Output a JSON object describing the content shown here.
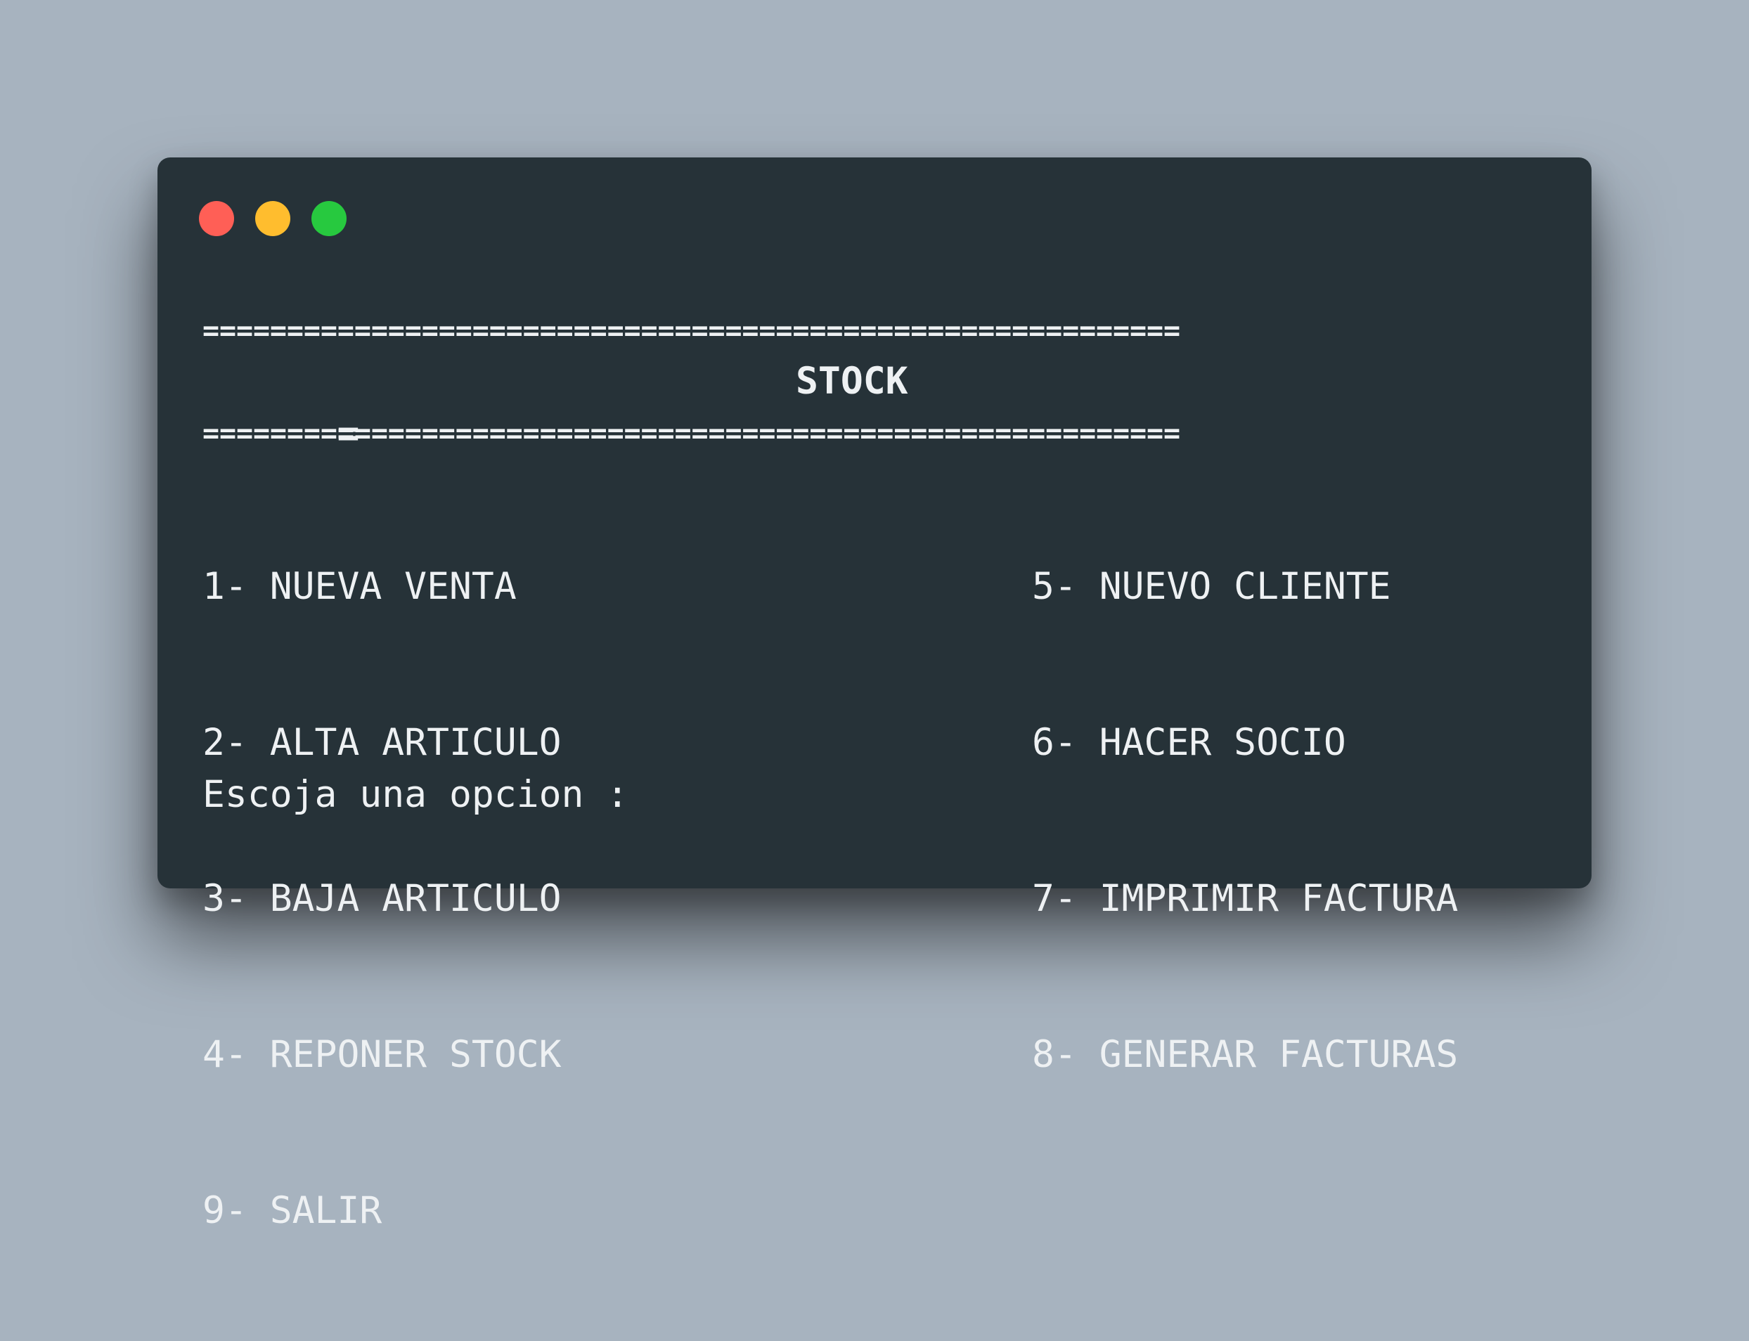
{
  "window": {
    "controls": {
      "close_color": "#ff5f56",
      "minimize_color": "#ffbd2e",
      "maximize_color": "#27c93f"
    }
  },
  "terminal": {
    "rule_top": "==========================================================",
    "banner_eq": "=",
    "banner_title": "STOCK",
    "rule_bottom": "==========================================================",
    "menu_left": [
      "1- NUEVA VENTA",
      "2- ALTA ARTICULO",
      "3- BAJA ARTICULO",
      "4- REPONER STOCK",
      "9- SALIR"
    ],
    "menu_right": [
      "5- NUEVO CLIENTE",
      "6- HACER SOCIO",
      "7- IMPRIMIR FACTURA",
      "8- GENERAR FACTURAS"
    ],
    "prompt": "Escoja una opcion :"
  }
}
